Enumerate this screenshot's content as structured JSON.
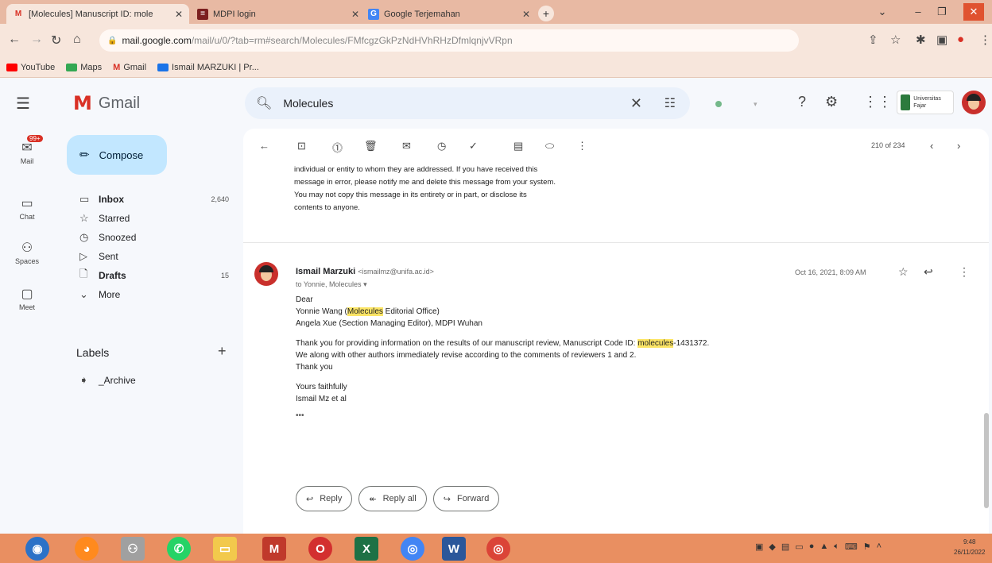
{
  "browser": {
    "tabs": [
      {
        "icon": "gmail-icon",
        "label": "[Molecules] Manuscript ID: mole",
        "active": true
      },
      {
        "icon": "mdpi-icon",
        "label": "MDPI login",
        "active": false
      },
      {
        "icon": "translate-icon",
        "label": "Google Terjemahan",
        "active": false
      }
    ],
    "url_host": "mail.google.com",
    "url_path": "/mail/u/0/?tab=rm#search/Molecules/FMfcgzGkPzNdHVhRHzDfmlqnjvVRpn",
    "bookmarks": [
      "YouTube",
      "Maps",
      "Gmail",
      "Ismail MARZUKI | Pr..."
    ]
  },
  "gmail": {
    "app_name": "Gmail",
    "search_value": "Molecules",
    "org_logo_text": "Universitas Fajar",
    "rail": [
      {
        "label": "Mail",
        "badge": "99+"
      },
      {
        "label": "Chat"
      },
      {
        "label": "Spaces"
      },
      {
        "label": "Meet"
      }
    ],
    "compose_label": "Compose",
    "nav": [
      {
        "label": "Inbox",
        "count": "2,640",
        "bold": true
      },
      {
        "label": "Starred",
        "count": ""
      },
      {
        "label": "Snoozed",
        "count": ""
      },
      {
        "label": "Sent",
        "count": ""
      },
      {
        "label": "Drafts",
        "count": "15",
        "bold": true
      },
      {
        "label": "More",
        "count": ""
      }
    ],
    "labels_heading": "Labels",
    "labels": [
      "_Archive"
    ],
    "pagination": "210 of 234",
    "previous_message_lines": [
      "individual or entity to whom they are addressed. If you have received this",
      "message in error, please notify me and delete this message from your system.",
      "You may not copy this message in its entirety or in part, or disclose its",
      "contents to anyone."
    ],
    "message": {
      "sender_name": "Ismail Marzuki",
      "sender_email": "<ismailmz@unifa.ac.id>",
      "to": "to Yonnie, Molecules",
      "date": "Oct 16, 2021, 8:09 AM",
      "greeting": "Dear",
      "line_recipient_1_pre": "Yonnie Wang (",
      "line_recipient_1_hl": "Molecules",
      "line_recipient_1_post": " Editorial Office)",
      "line_recipient_2": "Angela Xue (Section Managing Editor), MDPI Wuhan",
      "line_body_1_pre": "Thank you for providing information on the results of our manuscript review, Manuscript Code ID: ",
      "line_body_1_hl": "molecules",
      "line_body_1_post": "-1431372.",
      "line_body_2": "We along with other authors immediately revise according to the comments of reviewers 1 and 2.",
      "line_body_3": "Thank you",
      "closing_1": "Yours faithfully",
      "closing_2": "Ismail Mz et al",
      "trimmed": "•••"
    },
    "reply_label": "Reply",
    "reply_all_label": "Reply all",
    "forward_label": "Forward"
  },
  "taskbar": {
    "time": "9:48",
    "date": "26/11/2022"
  }
}
